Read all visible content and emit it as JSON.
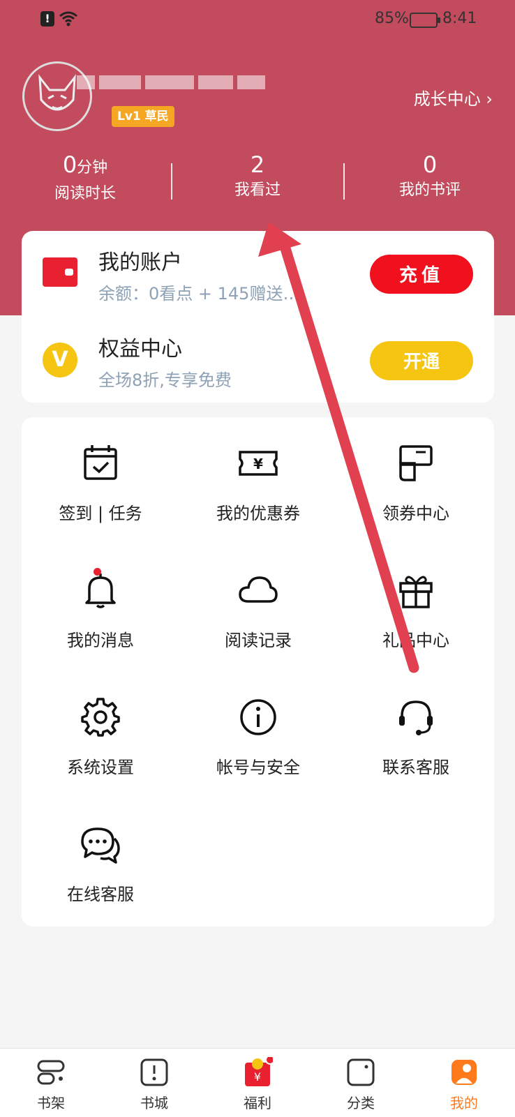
{
  "status_bar": {
    "battery_pct": "85%",
    "time": "8:41"
  },
  "profile": {
    "level_badge": "Lv1 草民",
    "growth_link": "成长中心"
  },
  "stats": [
    {
      "value": "0",
      "unit": "分钟",
      "label": "阅读时长"
    },
    {
      "value": "2",
      "unit": "",
      "label": "我看过"
    },
    {
      "value": "0",
      "unit": "",
      "label": "我的书评"
    }
  ],
  "account": {
    "title": "我的账户",
    "balance": "余额：0看点 + 145赠送…",
    "button": "充值"
  },
  "vip": {
    "title": "权益中心",
    "subtitle": "全场8折,专享免费",
    "button": "开通",
    "icon_letter": "V"
  },
  "grid": [
    {
      "icon": "calendar-check-icon",
      "label": "签到 | 任务"
    },
    {
      "icon": "coupon-ticket-icon",
      "label": "我的优惠券"
    },
    {
      "icon": "coupon-claim-icon",
      "label": "领券中心"
    },
    {
      "icon": "bell-icon",
      "label": "我的消息"
    },
    {
      "icon": "cloud-icon",
      "label": "阅读记录"
    },
    {
      "icon": "gift-icon",
      "label": "礼品中心"
    },
    {
      "icon": "gear-icon",
      "label": "系统设置"
    },
    {
      "icon": "info-icon",
      "label": "帐号与安全"
    },
    {
      "icon": "headset-icon",
      "label": "联系客服"
    },
    {
      "icon": "chat-bubbles-icon",
      "label": "在线客服"
    }
  ],
  "tabs": [
    {
      "icon": "bookshelf-icon",
      "label": "书架"
    },
    {
      "icon": "book-store-icon",
      "label": "书城"
    },
    {
      "icon": "red-envelope-icon",
      "label": "福利"
    },
    {
      "icon": "category-icon",
      "label": "分类"
    },
    {
      "icon": "profile-icon",
      "label": "我的",
      "active": true
    }
  ],
  "colors": {
    "header": "#c24b5e",
    "accent_red": "#f0101e",
    "accent_yellow": "#f5c511",
    "tab_active": "#ff7a1a",
    "arrow": "#e04050"
  }
}
